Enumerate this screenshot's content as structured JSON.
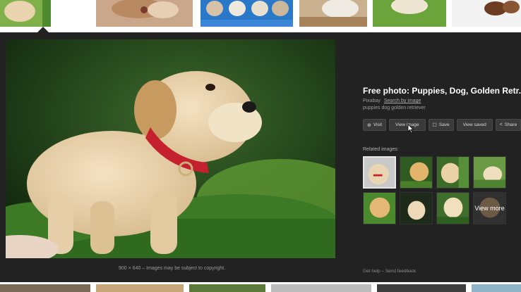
{
  "preview": {
    "caption": "900 × 640 – Images may be subject to copyright.",
    "title": "Free photo: Puppies, Dog, Golden Retr...",
    "source": "Pixabay",
    "search_by_image": "Search by image",
    "description": "puppies dog golden retriever",
    "actions": [
      {
        "icon": "globe-icon",
        "glyph": "⊕",
        "label": "Visit"
      },
      {
        "icon": "",
        "glyph": "",
        "label": "View image"
      },
      {
        "icon": "bookmark-icon",
        "glyph": "☐",
        "label": "Save"
      },
      {
        "icon": "",
        "glyph": "",
        "label": "View saved"
      },
      {
        "icon": "share-icon",
        "glyph": "<",
        "label": "Share"
      }
    ],
    "related_label": "Related images:",
    "view_more": "View more",
    "footer_help": "Get help",
    "footer_sep": " – ",
    "footer_feedback": "Send feedback"
  },
  "colors": {
    "panel": "#222222",
    "text_primary": "#ffffff",
    "text_secondary": "#9a9a9a",
    "button_bg": "#3a3a3a"
  }
}
